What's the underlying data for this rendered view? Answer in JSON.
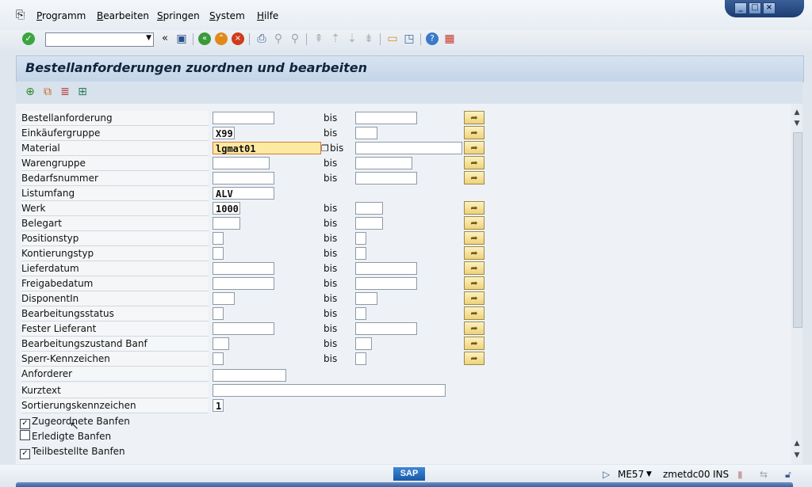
{
  "menu": {
    "items": [
      {
        "first": "P",
        "rest": "rogramm"
      },
      {
        "first": "B",
        "rest": "earbeiten"
      },
      {
        "first": "S",
        "rest": "pringen"
      },
      {
        "first": "S",
        "rest": "ystem"
      },
      {
        "first": "H",
        "rest": "ilfe"
      }
    ]
  },
  "toolbar": {
    "command_value": "",
    "icons": [
      "enter-icon",
      "back-double-icon",
      "save-icon",
      "back-icon",
      "exit-icon",
      "cancel-icon",
      "print-icon",
      "find-icon",
      "find-next-icon",
      "first-page-icon",
      "prev-page-icon",
      "next-page-icon",
      "last-page-icon",
      "new-session-icon",
      "shortcut-icon",
      "help-icon",
      "layout-icon"
    ]
  },
  "page": {
    "title": "Bestellanforderungen zuordnen und bearbeiten",
    "app_icons": [
      "execute-icon",
      "variant-icon",
      "selection-options-icon",
      "dynamic-selection-icon"
    ]
  },
  "form": {
    "bis_label": "bis",
    "rows": [
      {
        "label": "Bestellanforderung",
        "low": "",
        "high": "",
        "bis": "bis"
      },
      {
        "label": "Einkäufergruppe",
        "low": "X99",
        "high": "",
        "bis": "bis"
      },
      {
        "label": "Material",
        "low": "lgmat01",
        "high": "",
        "bis": "bis"
      },
      {
        "label": "Warengruppe",
        "low": "",
        "high": "",
        "bis": "bis"
      },
      {
        "label": "Bedarfsnummer",
        "low": "",
        "high": "",
        "bis": "bis"
      },
      {
        "label": "Listumfang",
        "low": "ALV"
      },
      {
        "label": "Werk",
        "low": "1000",
        "high": "",
        "bis": "bis"
      },
      {
        "label": "Belegart",
        "low": "",
        "high": "",
        "bis": "bis"
      },
      {
        "label": "Positionstyp",
        "low": "",
        "high": "",
        "bis": "bis"
      },
      {
        "label": "Kontierungstyp",
        "low": "",
        "high": "",
        "bis": "bis"
      },
      {
        "label": "Lieferdatum",
        "low": "",
        "high": "",
        "bis": "bis"
      },
      {
        "label": "Freigabedatum",
        "low": "",
        "high": "",
        "bis": "bis"
      },
      {
        "label": "DisponentIn",
        "low": "",
        "high": "",
        "bis": "bis"
      },
      {
        "label": "Bearbeitungsstatus",
        "low": "",
        "high": "",
        "bis": "bis"
      },
      {
        "label": "Fester Lieferant",
        "low": "",
        "high": "",
        "bis": "bis"
      },
      {
        "label": "Bearbeitungszustand Banf",
        "low": "",
        "high": "",
        "bis": "bis"
      },
      {
        "label": "Sperr-Kennzeichen",
        "low": "",
        "high": "",
        "bis": "bis"
      },
      {
        "label": "Anforderer",
        "low": ""
      },
      {
        "label": "Kurztext",
        "low": ""
      },
      {
        "label": "Sortierungskennzeichen",
        "low": "1"
      }
    ],
    "checkboxes": [
      {
        "label": "Zugeordnete Banfen",
        "checked": true
      },
      {
        "label": "Erledigte Banfen",
        "checked": false
      },
      {
        "label": "Teilbestellte Banfen",
        "checked": true
      }
    ]
  },
  "status": {
    "transaction": "ME57",
    "server": "zmetdc00",
    "mode": "INS",
    "logo": "SAP"
  }
}
